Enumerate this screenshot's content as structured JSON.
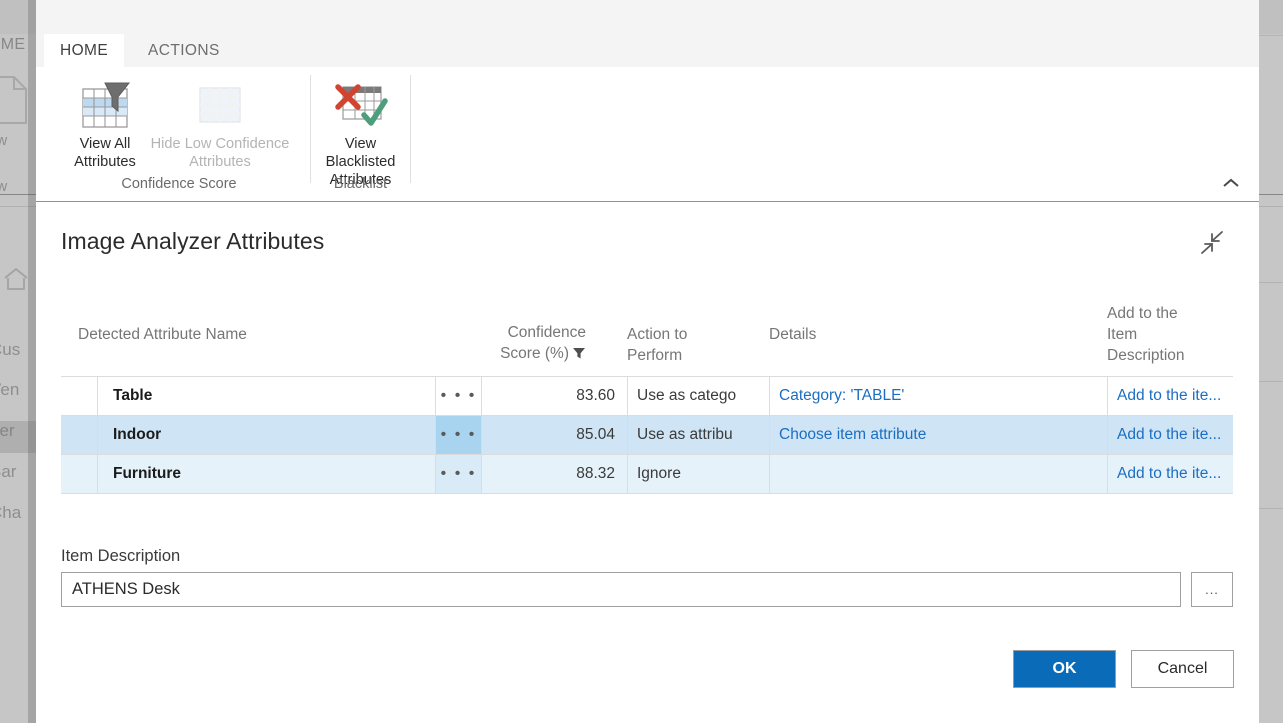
{
  "background": {
    "tab_home_label": "OME",
    "new_label_1": "ew",
    "new_label_2": "ew",
    "nav_items": [
      {
        "label": "Cus",
        "selected": false
      },
      {
        "label": "Ven",
        "selected": false
      },
      {
        "label": "Iter",
        "selected": true
      },
      {
        "label": "Bar",
        "selected": false
      },
      {
        "label": "Cha",
        "selected": false
      }
    ]
  },
  "ribbon": {
    "tabs": [
      {
        "label": "HOME",
        "active": true
      },
      {
        "label": "ACTIONS",
        "active": false
      }
    ],
    "collapse_icon": "chevron-up-icon",
    "groups": [
      {
        "name": "Confidence Score",
        "label": "Confidence Score",
        "buttons": [
          {
            "id": "view-all-attributes",
            "line1": "View All",
            "line2": "Attributes",
            "icon": "grid-filter-icon",
            "disabled": false
          },
          {
            "id": "hide-low-confidence-attributes",
            "line1": "Hide Low Confidence",
            "line2": "Attributes",
            "icon": "grid-disabled-icon",
            "disabled": true
          }
        ]
      },
      {
        "name": "Blacklist",
        "label": "Blacklist",
        "buttons": [
          {
            "id": "view-blacklisted-attributes",
            "line1": "View Blacklisted",
            "line2": "Attributes",
            "icon": "grid-cross-check-icon",
            "disabled": false
          }
        ]
      }
    ]
  },
  "dialog": {
    "title": "Image Analyzer Attributes",
    "collapse_icon": "collapse-diagonal-arrows-icon",
    "table": {
      "columns": [
        {
          "key": "name",
          "label": "Detected Attribute Name",
          "align": "left"
        },
        {
          "key": "dots",
          "label": "",
          "align": "center"
        },
        {
          "key": "score",
          "label_line1": "Confidence",
          "label_line2": "Score (%)",
          "align": "right",
          "filter_icon": "funnel-filter-icon"
        },
        {
          "key": "action",
          "label_line1": "Action to",
          "label_line2": "Perform",
          "align": "left"
        },
        {
          "key": "details",
          "label": "Details",
          "align": "left"
        },
        {
          "key": "add",
          "label_line1": "Add to the",
          "label_line2": "Item",
          "label_line3": "Description",
          "align": "left"
        }
      ],
      "rows": [
        {
          "name": "Table",
          "dots": "• • •",
          "score": "83.60",
          "action": "Use as catego",
          "details": "Category: 'TABLE'",
          "add": "Add to the ite...",
          "selected": false,
          "alt": false
        },
        {
          "name": "Indoor",
          "dots": "• • •",
          "score": "85.04",
          "action": "Use as attribu",
          "details": "Choose item attribute",
          "add": "Add to the ite...",
          "selected": true,
          "alt": false
        },
        {
          "name": "Furniture",
          "dots": "• • •",
          "score": "88.32",
          "action": "Ignore",
          "details": "",
          "add": "Add to the ite...",
          "selected": false,
          "alt": true
        }
      ]
    },
    "item_description": {
      "label": "Item Description",
      "value": "ATHENS Desk",
      "placeholder": "",
      "ellipsis_label": "..."
    },
    "footer": {
      "ok_label": "OK",
      "cancel_label": "Cancel"
    }
  },
  "colors": {
    "accent": "#0a6cb8",
    "link": "#1b6ec2",
    "row_selected": "#cfe5f5",
    "row_alt": "#e6f2fa",
    "grid_line": "#dcdcdc"
  }
}
